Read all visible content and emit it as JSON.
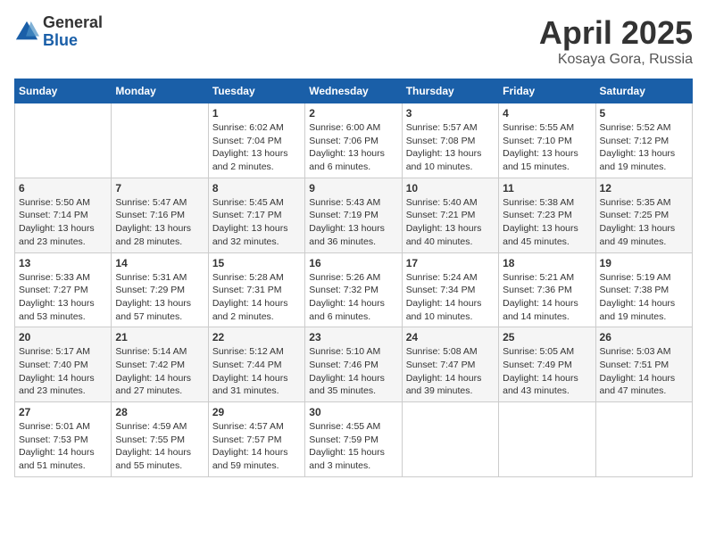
{
  "header": {
    "logo_general": "General",
    "logo_blue": "Blue",
    "month_title": "April 2025",
    "location": "Kosaya Gora, Russia"
  },
  "weekdays": [
    "Sunday",
    "Monday",
    "Tuesday",
    "Wednesday",
    "Thursday",
    "Friday",
    "Saturday"
  ],
  "weeks": [
    [
      {
        "day": null
      },
      {
        "day": null
      },
      {
        "day": "1",
        "sunrise": "6:02 AM",
        "sunset": "7:04 PM",
        "daylight": "13 hours and 2 minutes."
      },
      {
        "day": "2",
        "sunrise": "6:00 AM",
        "sunset": "7:06 PM",
        "daylight": "13 hours and 6 minutes."
      },
      {
        "day": "3",
        "sunrise": "5:57 AM",
        "sunset": "7:08 PM",
        "daylight": "13 hours and 10 minutes."
      },
      {
        "day": "4",
        "sunrise": "5:55 AM",
        "sunset": "7:10 PM",
        "daylight": "13 hours and 15 minutes."
      },
      {
        "day": "5",
        "sunrise": "5:52 AM",
        "sunset": "7:12 PM",
        "daylight": "13 hours and 19 minutes."
      }
    ],
    [
      {
        "day": "6",
        "sunrise": "5:50 AM",
        "sunset": "7:14 PM",
        "daylight": "13 hours and 23 minutes."
      },
      {
        "day": "7",
        "sunrise": "5:47 AM",
        "sunset": "7:16 PM",
        "daylight": "13 hours and 28 minutes."
      },
      {
        "day": "8",
        "sunrise": "5:45 AM",
        "sunset": "7:17 PM",
        "daylight": "13 hours and 32 minutes."
      },
      {
        "day": "9",
        "sunrise": "5:43 AM",
        "sunset": "7:19 PM",
        "daylight": "13 hours and 36 minutes."
      },
      {
        "day": "10",
        "sunrise": "5:40 AM",
        "sunset": "7:21 PM",
        "daylight": "13 hours and 40 minutes."
      },
      {
        "day": "11",
        "sunrise": "5:38 AM",
        "sunset": "7:23 PM",
        "daylight": "13 hours and 45 minutes."
      },
      {
        "day": "12",
        "sunrise": "5:35 AM",
        "sunset": "7:25 PM",
        "daylight": "13 hours and 49 minutes."
      }
    ],
    [
      {
        "day": "13",
        "sunrise": "5:33 AM",
        "sunset": "7:27 PM",
        "daylight": "13 hours and 53 minutes."
      },
      {
        "day": "14",
        "sunrise": "5:31 AM",
        "sunset": "7:29 PM",
        "daylight": "13 hours and 57 minutes."
      },
      {
        "day": "15",
        "sunrise": "5:28 AM",
        "sunset": "7:31 PM",
        "daylight": "14 hours and 2 minutes."
      },
      {
        "day": "16",
        "sunrise": "5:26 AM",
        "sunset": "7:32 PM",
        "daylight": "14 hours and 6 minutes."
      },
      {
        "day": "17",
        "sunrise": "5:24 AM",
        "sunset": "7:34 PM",
        "daylight": "14 hours and 10 minutes."
      },
      {
        "day": "18",
        "sunrise": "5:21 AM",
        "sunset": "7:36 PM",
        "daylight": "14 hours and 14 minutes."
      },
      {
        "day": "19",
        "sunrise": "5:19 AM",
        "sunset": "7:38 PM",
        "daylight": "14 hours and 19 minutes."
      }
    ],
    [
      {
        "day": "20",
        "sunrise": "5:17 AM",
        "sunset": "7:40 PM",
        "daylight": "14 hours and 23 minutes."
      },
      {
        "day": "21",
        "sunrise": "5:14 AM",
        "sunset": "7:42 PM",
        "daylight": "14 hours and 27 minutes."
      },
      {
        "day": "22",
        "sunrise": "5:12 AM",
        "sunset": "7:44 PM",
        "daylight": "14 hours and 31 minutes."
      },
      {
        "day": "23",
        "sunrise": "5:10 AM",
        "sunset": "7:46 PM",
        "daylight": "14 hours and 35 minutes."
      },
      {
        "day": "24",
        "sunrise": "5:08 AM",
        "sunset": "7:47 PM",
        "daylight": "14 hours and 39 minutes."
      },
      {
        "day": "25",
        "sunrise": "5:05 AM",
        "sunset": "7:49 PM",
        "daylight": "14 hours and 43 minutes."
      },
      {
        "day": "26",
        "sunrise": "5:03 AM",
        "sunset": "7:51 PM",
        "daylight": "14 hours and 47 minutes."
      }
    ],
    [
      {
        "day": "27",
        "sunrise": "5:01 AM",
        "sunset": "7:53 PM",
        "daylight": "14 hours and 51 minutes."
      },
      {
        "day": "28",
        "sunrise": "4:59 AM",
        "sunset": "7:55 PM",
        "daylight": "14 hours and 55 minutes."
      },
      {
        "day": "29",
        "sunrise": "4:57 AM",
        "sunset": "7:57 PM",
        "daylight": "14 hours and 59 minutes."
      },
      {
        "day": "30",
        "sunrise": "4:55 AM",
        "sunset": "7:59 PM",
        "daylight": "15 hours and 3 minutes."
      },
      {
        "day": null
      },
      {
        "day": null
      },
      {
        "day": null
      }
    ]
  ],
  "labels": {
    "sunrise": "Sunrise:",
    "sunset": "Sunset:",
    "daylight": "Daylight:"
  }
}
